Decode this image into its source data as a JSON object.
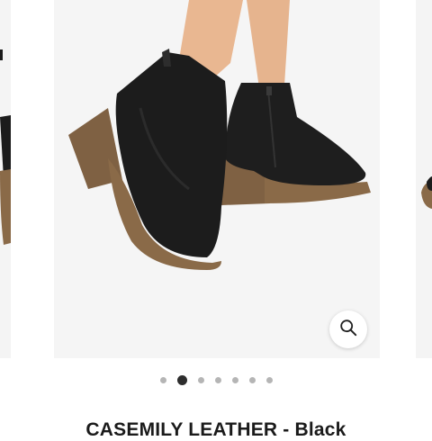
{
  "product": {
    "title": "CASEMILY LEATHER - Black"
  },
  "gallery": {
    "image_count": 7,
    "active_index": 1,
    "zoom_icon": "magnifier-icon"
  },
  "colors": {
    "leather": "#1c1c1c",
    "sole": "#8a6a48",
    "skin": "#e9b791",
    "dot_active": "#2d2d2d",
    "dot_inactive": "#b5b5b5"
  }
}
